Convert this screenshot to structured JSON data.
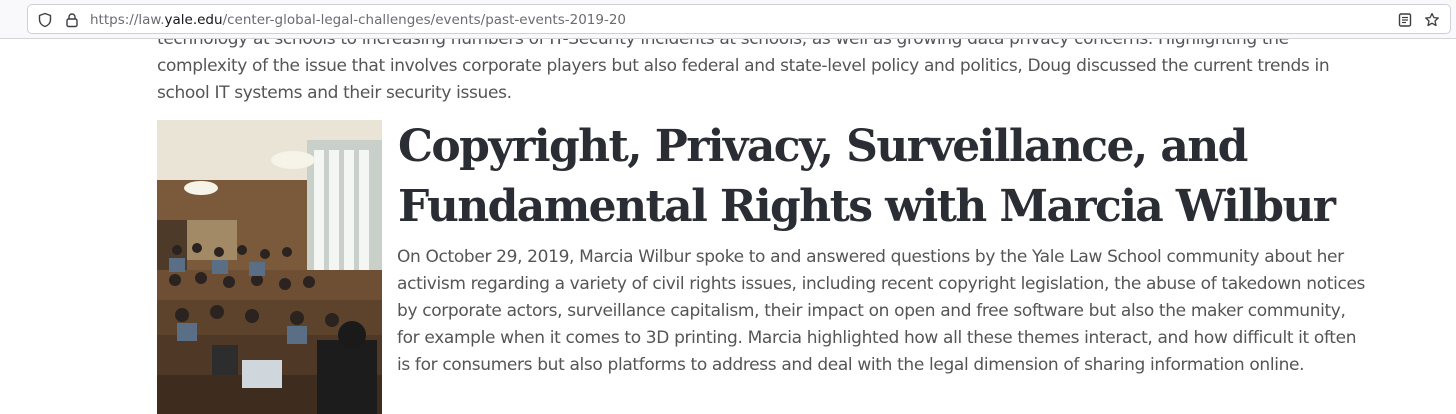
{
  "browser": {
    "url_prefix": "https://law.",
    "url_host": "yale.edu",
    "url_path": "/center-global-legal-challenges/events/past-events-2019-20",
    "icons": [
      "shield-icon",
      "lock-icon",
      "reader-view-icon",
      "bookmark-star-icon"
    ]
  },
  "page": {
    "previous_paragraph": "technology at schools to increasing numbers of IT-Security incidents at schools, as well as growing data privacy concerns. Highlighting the complexity of the issue that involves corporate players but also federal and state-level policy and politics, Doug discussed the current trends in school IT systems and their security issues.",
    "event": {
      "title": "Copyright, Privacy, Surveillance, and Fundamental Rights with Marcia Wilbur",
      "description": "On October 29, 2019, Marcia Wilbur spoke to and answered questions by the Yale Law School community about her activism regarding a variety of civil rights issues, including recent copyright legislation, the abuse of takedown notices by corporate actors, surveillance capitalism, their impact on open and free software but also the maker community, for example when it comes to 3D printing. Marcia highlighted how all these themes interact, and how difficult it often is for consumers but also platforms to address and deal with the legal dimension of sharing information online."
    }
  }
}
